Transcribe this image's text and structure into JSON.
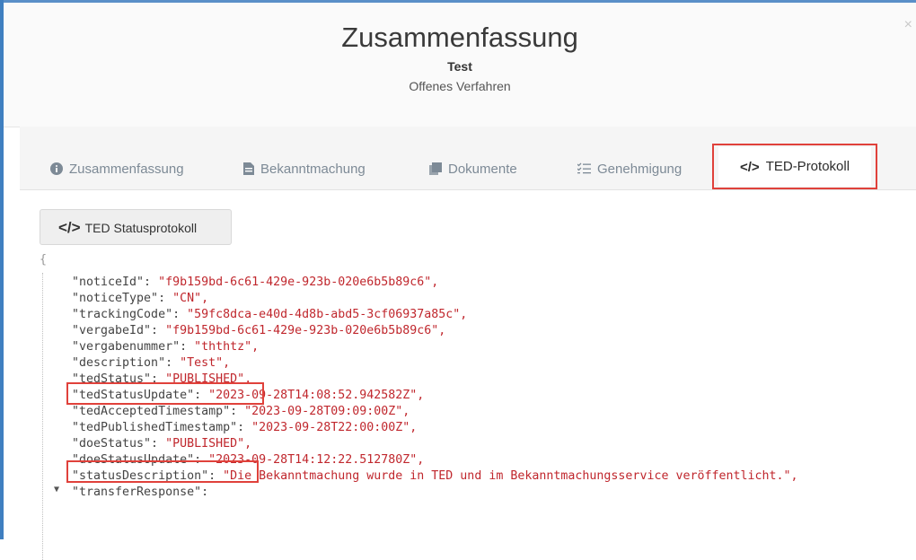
{
  "header": {
    "title": "Zusammenfassung",
    "subtitle": "Test",
    "procedure": "Offenes Verfahren",
    "close": "×"
  },
  "tabs": [
    {
      "label": "Zusammenfassung",
      "icon": "info-circle-icon",
      "glyph": "●"
    },
    {
      "label": "Bekanntmachung",
      "icon": "document-icon",
      "glyph": "▉"
    },
    {
      "label": "Dokumente",
      "icon": "copy-icon",
      "glyph": "▉"
    },
    {
      "label": "Genehmigung",
      "icon": "list-check-icon",
      "glyph": "☰"
    },
    {
      "label": "TED-Protokoll",
      "icon": "code-icon",
      "glyph": "</>",
      "active": true
    }
  ],
  "button": {
    "code": "</>",
    "label": "TED Statusprotokoll"
  },
  "json": {
    "open_brace": "{",
    "lines": [
      {
        "key": "\"noticeId\": ",
        "value": "\"f9b159bd-6c61-429e-923b-020e6b5b89c6\","
      },
      {
        "key": "\"noticeType\": ",
        "value": "\"CN\","
      },
      {
        "key": "\"trackingCode\": ",
        "value": "\"59fc8dca-e40d-4d8b-abd5-3cf06937a85c\","
      },
      {
        "key": "\"vergabeId\": ",
        "value": "\"f9b159bd-6c61-429e-923b-020e6b5b89c6\","
      },
      {
        "key": "\"vergabenummer\": ",
        "value": "\"ththtz\","
      },
      {
        "key": "\"description\": ",
        "value": "\"Test\","
      },
      {
        "key": "\"tedStatus\": ",
        "value": "\"PUBLISHED\","
      },
      {
        "key": "\"tedStatusUpdate\": ",
        "value": "\"2023-09-28T14:08:52.942582Z\","
      },
      {
        "key": "\"tedAcceptedTimestamp\": ",
        "value": "\"2023-09-28T09:09:00Z\","
      },
      {
        "key": "\"tedPublishedTimestamp\": ",
        "value": "\"2023-09-28T22:00:00Z\","
      },
      {
        "key": "\"doeStatus\": ",
        "value": "\"PUBLISHED\","
      },
      {
        "key": "\"doeStatusUpdate\": ",
        "value": "\"2023-09-28T14:12:22.512780Z\","
      },
      {
        "key": "\"statusDescription\": ",
        "value": "\"Die Bekanntmachung wurde in TED und im Bekanntmachungsservice veröffentlicht.\","
      },
      {
        "key": "\"transferResponse\":",
        "value": ""
      }
    ],
    "collapse_arrow": "▼"
  },
  "colors": {
    "accent_red": "#e0413b",
    "value_red": "#c0272d",
    "frame_blue": "#3f7fc0"
  }
}
